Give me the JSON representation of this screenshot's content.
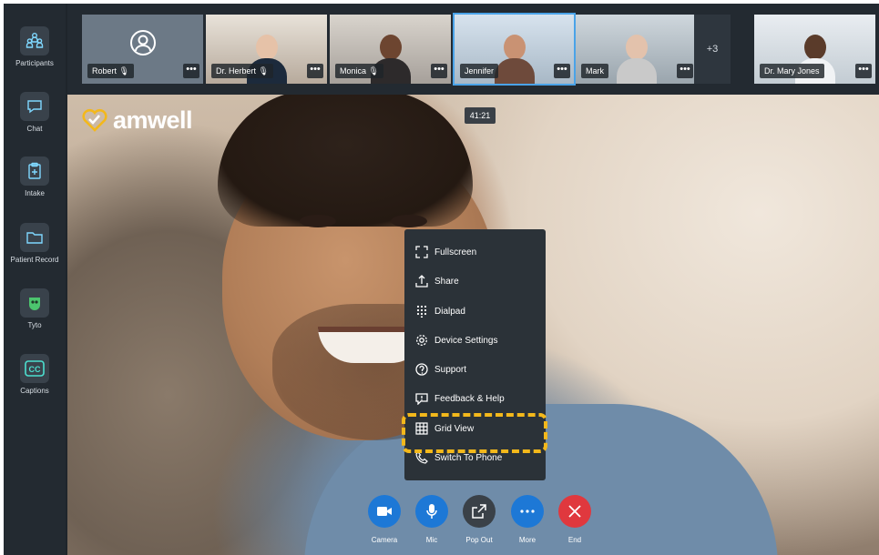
{
  "sidebar": {
    "items": [
      {
        "label": "Participants",
        "icon": "participants-icon"
      },
      {
        "label": "Chat",
        "icon": "chat-icon"
      },
      {
        "label": "Intake",
        "icon": "clipboard-icon"
      },
      {
        "label": "Patient Record",
        "icon": "folder-icon"
      },
      {
        "label": "Tyto",
        "icon": "tyto-icon"
      },
      {
        "label": "Captions",
        "icon": "cc-icon"
      }
    ]
  },
  "participants": {
    "tiles": [
      {
        "name": "Robert",
        "mic": true,
        "menu": "•••"
      },
      {
        "name": "Dr. Herbert",
        "mic": true,
        "menu": "•••"
      },
      {
        "name": "Monica",
        "mic": true,
        "menu": "•••"
      },
      {
        "name": "Jennifer",
        "mic": false,
        "menu": "•••"
      },
      {
        "name": "Mark",
        "mic": false,
        "menu": "•••"
      },
      {
        "name": "Dr. Mary Jones",
        "mic": false,
        "menu": "•••"
      }
    ],
    "overflow_count": "+3"
  },
  "brand": {
    "logo_text": "amwell",
    "accent": "#f3b81b"
  },
  "timer": "41:21",
  "more_menu": {
    "items": [
      {
        "label": "Fullscreen",
        "icon": "fullscreen-icon"
      },
      {
        "label": "Share",
        "icon": "share-icon"
      },
      {
        "label": "Dialpad",
        "icon": "dialpad-icon"
      },
      {
        "label": "Device Settings",
        "icon": "gear-icon"
      },
      {
        "label": "Support",
        "icon": "help-icon"
      },
      {
        "label": "Feedback & Help",
        "icon": "feedback-icon"
      },
      {
        "label": "Grid View",
        "icon": "grid-icon"
      },
      {
        "label": "Switch To Phone",
        "icon": "phone-icon"
      }
    ],
    "highlighted": "Grid View"
  },
  "controls": [
    {
      "label": "Camera",
      "color": "#1d78d6",
      "icon": "camera-icon"
    },
    {
      "label": "Mic",
      "color": "#1d78d6",
      "icon": "mic-icon"
    },
    {
      "label": "Pop Out",
      "color": "#3a4148",
      "icon": "popout-icon"
    },
    {
      "label": "More",
      "color": "#1d78d6",
      "icon": "more-icon"
    },
    {
      "label": "End",
      "color": "#e0383e",
      "icon": "end-call-icon"
    }
  ]
}
